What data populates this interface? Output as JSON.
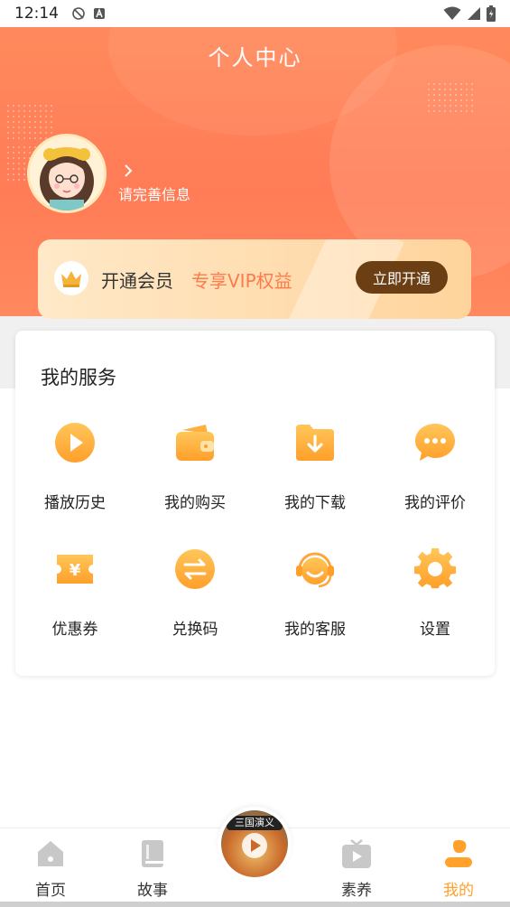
{
  "status_bar": {
    "time": "12:14",
    "left_icons": [
      "no-sim-icon",
      "keyboard-a-icon"
    ],
    "right_icons": [
      "wifi-icon",
      "signal-icon",
      "battery-icon"
    ]
  },
  "header": {
    "title": "个人中心",
    "accent_color": "#ff7c57"
  },
  "profile": {
    "avatar_icon": "girl-avatar-icon",
    "prompt": "请完善信息"
  },
  "vip": {
    "title": "开通会员",
    "subtitle": "专享VIP权益",
    "button": "立即开通",
    "icon": "crown-icon"
  },
  "services": {
    "title": "我的服务",
    "items": [
      {
        "label": "播放历史",
        "icon": "play-circle-icon"
      },
      {
        "label": "我的购买",
        "icon": "wallet-icon"
      },
      {
        "label": "我的下载",
        "icon": "download-folder-icon"
      },
      {
        "label": "我的评价",
        "icon": "comment-bubble-icon"
      },
      {
        "label": "优惠券",
        "icon": "coupon-icon"
      },
      {
        "label": "兑换码",
        "icon": "exchange-icon"
      },
      {
        "label": "我的客服",
        "icon": "headset-icon"
      },
      {
        "label": "设置",
        "icon": "gear-icon"
      }
    ]
  },
  "bottom_nav": {
    "items": [
      {
        "label": "首页",
        "icon": "home-icon",
        "active": false
      },
      {
        "label": "故事",
        "icon": "book-icon",
        "active": false
      },
      {
        "label": "素养",
        "icon": "tv-play-icon",
        "active": false
      },
      {
        "label": "我的",
        "icon": "person-icon",
        "active": true
      }
    ],
    "center": {
      "banner": "三国演义",
      "icon": "play-disc-icon"
    },
    "active_color": "#ffa12b"
  }
}
